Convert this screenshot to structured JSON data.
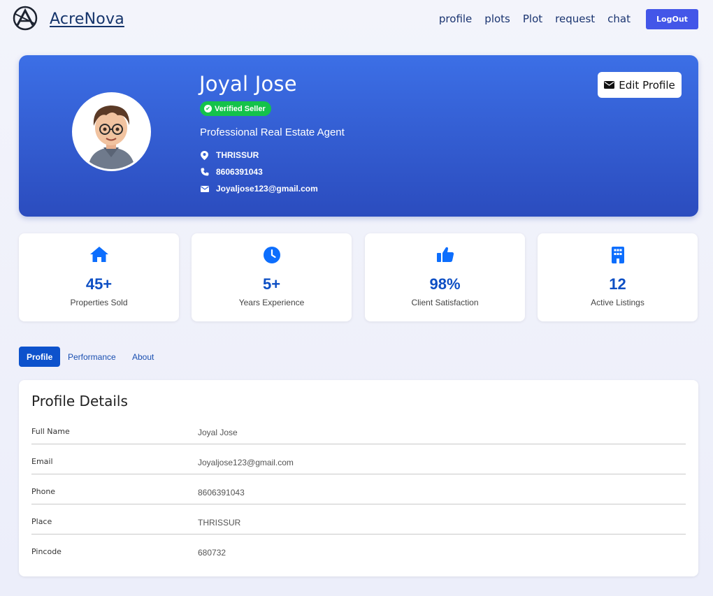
{
  "brand": {
    "name": "AcreNova"
  },
  "nav": {
    "links": [
      "profile",
      "plots",
      "Plot",
      "request",
      "chat"
    ],
    "logout_label": "LogOut"
  },
  "hero": {
    "name": "Joyal Jose",
    "badge": "Verified Seller",
    "title": "Professional Real Estate Agent",
    "location": "THRISSUR",
    "phone": "8606391043",
    "email": "Joyaljose123@gmail.com",
    "edit_label": "Edit Profile"
  },
  "stats": [
    {
      "icon": "home-icon",
      "value": "45+",
      "label": "Properties Sold"
    },
    {
      "icon": "clock-icon",
      "value": "5+",
      "label": "Years Experience"
    },
    {
      "icon": "thumbs-up-icon",
      "value": "98%",
      "label": "Client Satisfaction"
    },
    {
      "icon": "building-icon",
      "value": "12",
      "label": "Active Listings"
    }
  ],
  "tabs": [
    "Profile",
    "Performance",
    "About"
  ],
  "details": {
    "title": "Profile Details",
    "rows": [
      {
        "label": "Full Name",
        "value": "Joyal Jose"
      },
      {
        "label": "Email",
        "value": "Joyaljose123@gmail.com"
      },
      {
        "label": "Phone",
        "value": "8606391043"
      },
      {
        "label": "Place",
        "value": "THRISSUR"
      },
      {
        "label": "Pincode",
        "value": "680732"
      }
    ]
  },
  "colors": {
    "accent": "#0d52cc",
    "hero_top": "#3c6fe6",
    "hero_bottom": "#2b4cbe",
    "verified": "#14c24a",
    "logout": "#4356e8",
    "stat_value": "#0d4fc4"
  }
}
